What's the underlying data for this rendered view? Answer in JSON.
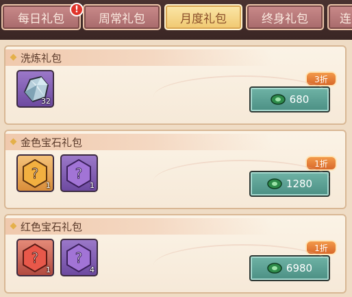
{
  "tabs": [
    {
      "label": "每日礼包",
      "alert": "!"
    },
    {
      "label": "周常礼包"
    },
    {
      "label": "月度礼包",
      "active": true
    },
    {
      "label": "终身礼包"
    },
    {
      "label": "连"
    }
  ],
  "packs": [
    {
      "title": "洗炼礼包",
      "items": [
        {
          "icon": "crystal-ore-icon",
          "color": "purple",
          "qty": "32"
        }
      ],
      "discount": "3折",
      "price": "680"
    },
    {
      "title": "金色宝石礼包",
      "items": [
        {
          "icon": "gold-gem-icon",
          "color": "orange",
          "qty": "1"
        },
        {
          "icon": "purple-gem-icon",
          "color": "purple",
          "qty": "1"
        }
      ],
      "discount": "1折",
      "price": "1280"
    },
    {
      "title": "红色宝石礼包",
      "items": [
        {
          "icon": "red-gem-icon",
          "color": "red",
          "qty": "1"
        },
        {
          "icon": "purple-gem-icon",
          "color": "purple",
          "qty": "4"
        }
      ],
      "discount": "1折",
      "price": "6980"
    }
  ],
  "currency_icon": "jade-currency-icon",
  "colors": {
    "accent": "#f0c870",
    "price_button": "#5aa396",
    "discount": "#e87e3a"
  }
}
